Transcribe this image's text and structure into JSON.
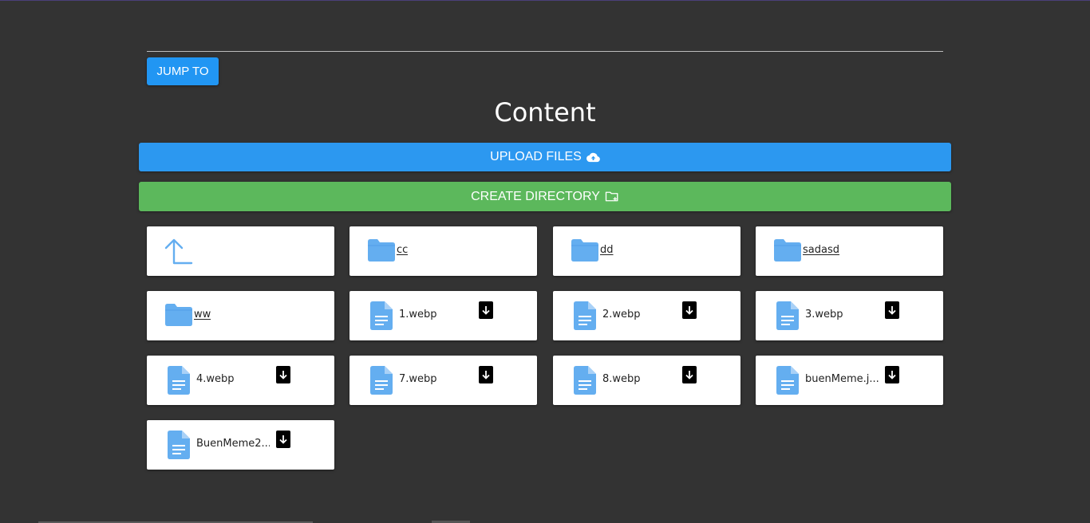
{
  "toolbar": {
    "jump_label": "JUMP TO"
  },
  "page": {
    "title": "Content"
  },
  "actions": {
    "upload_label": "UPLOAD FILES",
    "upload_icon": "cloud-upload-icon",
    "create_label": "CREATE DIRECTORY",
    "create_icon": "folder-plus-icon"
  },
  "colors": {
    "background": "#333333",
    "accent_blue": "#2196f3",
    "create_green": "#5cb85c",
    "icon_blue": "#64aef0"
  },
  "items": [
    {
      "type": "parent",
      "icon": "arrow-up-left-icon"
    },
    {
      "type": "folder",
      "name": "cc",
      "icon": "folder-icon"
    },
    {
      "type": "folder",
      "name": "dd",
      "icon": "folder-icon"
    },
    {
      "type": "folder",
      "name": "sadasd",
      "icon": "folder-icon"
    },
    {
      "type": "folder",
      "name": "ww",
      "icon": "folder-icon"
    },
    {
      "type": "file",
      "name": "1.webp",
      "icon": "file-icon"
    },
    {
      "type": "file",
      "name": "2.webp",
      "icon": "file-icon"
    },
    {
      "type": "file",
      "name": "3.webp",
      "icon": "file-icon"
    },
    {
      "type": "file",
      "name": "4.webp",
      "icon": "file-icon"
    },
    {
      "type": "file",
      "name": "7.webp",
      "icon": "file-icon"
    },
    {
      "type": "file",
      "name": "8.webp",
      "icon": "file-icon"
    },
    {
      "type": "file",
      "name": "buenMeme.j...",
      "icon": "file-icon"
    },
    {
      "type": "file",
      "name": "BuenMeme2....",
      "icon": "file-icon"
    }
  ]
}
